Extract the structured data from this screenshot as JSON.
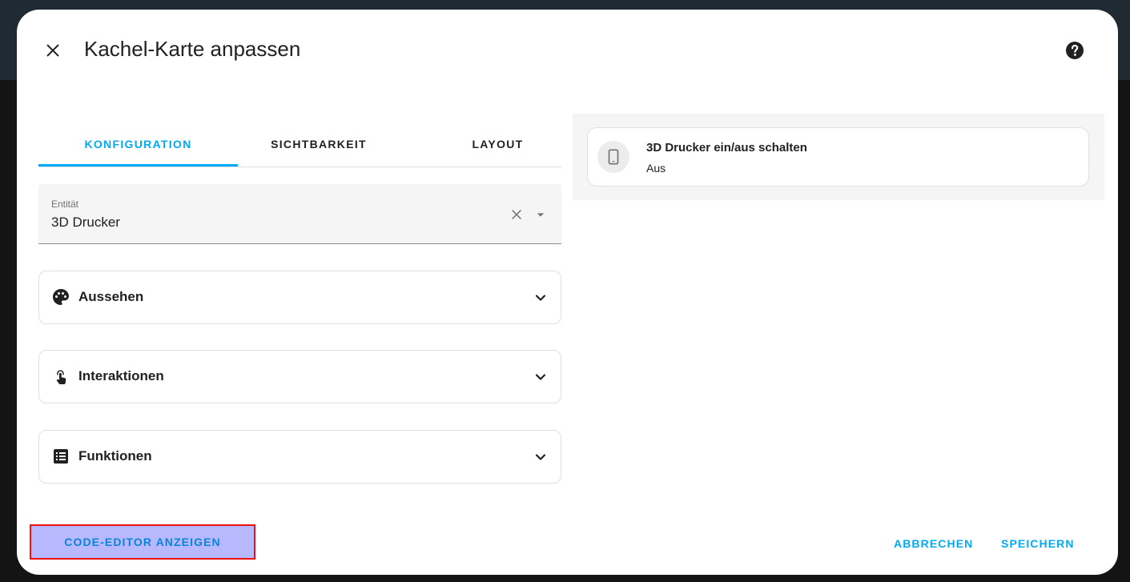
{
  "dialog": {
    "title": "Kachel-Karte anpassen"
  },
  "tabs": [
    {
      "label": "KONFIGURATION",
      "active": true
    },
    {
      "label": "SICHTBARKEIT",
      "active": false
    },
    {
      "label": "LAYOUT",
      "active": false
    }
  ],
  "entity_field": {
    "label": "Entität",
    "value": "3D Drucker"
  },
  "panels": [
    {
      "label": "Aussehen",
      "icon": "palette-icon"
    },
    {
      "label": "Interaktionen",
      "icon": "gesture-tap-icon"
    },
    {
      "label": "Funktionen",
      "icon": "list-box-icon"
    }
  ],
  "preview": {
    "tile_name": "3D Drucker ein/aus schalten",
    "tile_state": "Aus",
    "tile_icon": "tablet-icon"
  },
  "footer": {
    "code_editor_label": "CODE-EDITOR ANZEIGEN",
    "cancel_label": "ABBRECHEN",
    "save_label": "SPEICHERN"
  },
  "colors": {
    "accent": "#03a9f4",
    "highlight_fill": "#b8b8ff",
    "highlight_border": "#ee1111"
  }
}
